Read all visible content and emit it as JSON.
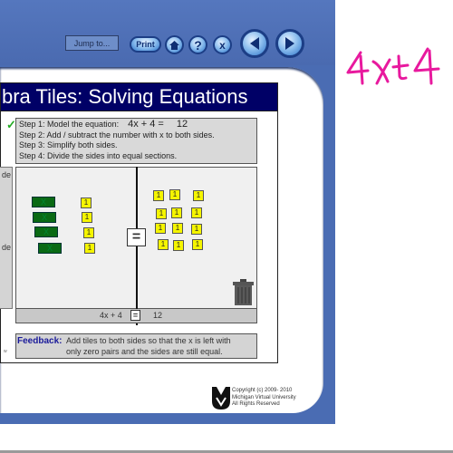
{
  "toolbar": {
    "jump_label": "Jump to...",
    "print_label": "Print",
    "home_icon": "home-icon",
    "help_icon": "question-icon",
    "close_icon": "x-icon",
    "back_icon": "left-arrow-icon",
    "forward_icon": "right-arrow-icon"
  },
  "title": "bra Tiles: Solving Equations",
  "steps": {
    "checkmark": "✓",
    "step1": "Step 1: Model the equation:",
    "equation_left": "4x + 4  =",
    "equation_right": "12",
    "step2": "Step 2: Add / subtract the number with x to both sides.",
    "step3": "Step 3: Simplify both sides.",
    "step4": "Step 4: Divide the sides into equal sections."
  },
  "left_panel": {
    "text_top": "de",
    "text_bottom": "de"
  },
  "workspace": {
    "equals": "=",
    "left_x_tiles": [
      "X",
      "X",
      "X",
      "X"
    ],
    "left_unit_tiles": [
      "1",
      "1",
      "1",
      "1"
    ],
    "right_unit_tiles": [
      "1",
      "1",
      "1",
      "1",
      "1",
      "1",
      "1",
      "1",
      "1",
      "1",
      "1",
      "1"
    ],
    "trash_icon": "trash-can-icon"
  },
  "summary": {
    "left": "4x + 4",
    "equals": "=",
    "right": "12"
  },
  "feedback": {
    "label": "Feedback:",
    "line1": "Add tiles to both sides so that the x is left with",
    "line2": "only zero pairs and the sides are still equal."
  },
  "side_fragment": "w",
  "footer": {
    "line1": "Copyright (c) 2009- 2010",
    "line2": "Michigan Virtual University",
    "line3": "All Rights Reserved"
  },
  "annotation": {
    "text": "4x+4",
    "color": "#e8199e"
  },
  "colors": {
    "frame_blue": "#4a6cb3",
    "title_navy": "#000066",
    "x_tile_green": "#0a6a14",
    "unit_tile_yellow": "#f5f500"
  }
}
